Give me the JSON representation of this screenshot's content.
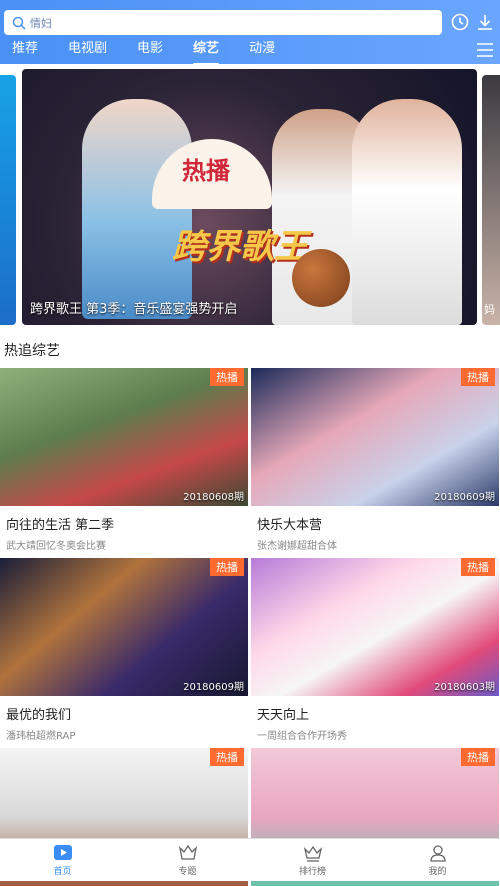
{
  "search": {
    "placeholder": "情妇"
  },
  "header_icons": [
    "history-icon",
    "download-icon"
  ],
  "tabs": [
    {
      "label": "推荐"
    },
    {
      "label": "电视剧"
    },
    {
      "label": "电影"
    },
    {
      "label": "综艺",
      "active": true
    },
    {
      "label": "动漫"
    }
  ],
  "banner": {
    "caption": "跨界歌王 第3季：音乐盛宴强势开启",
    "fan_text": "热播",
    "logo_text": "跨界歌王",
    "right_peek": "妈"
  },
  "section": {
    "title": "热追综艺"
  },
  "cards": [
    {
      "badge": "热播",
      "date": "20180608期",
      "name": "向往的生活 第二季",
      "desc": "武大靖回忆冬奥会比赛"
    },
    {
      "badge": "热播",
      "date": "20180609期",
      "name": "快乐大本营",
      "desc": "张杰谢娜超甜合体"
    },
    {
      "badge": "热播",
      "date": "20180609期",
      "name": "最优的我们",
      "desc": "潘玮柏超燃RAP"
    },
    {
      "badge": "热播",
      "date": "20180603期",
      "name": "天天向上",
      "desc": "一周组合合作开场秀"
    },
    {
      "badge": "热播",
      "date": "",
      "name": "",
      "desc": ""
    },
    {
      "badge": "热播",
      "date": "",
      "name": "",
      "desc": ""
    }
  ],
  "bottom_nav": [
    {
      "label": "首页",
      "icon": "home-play-icon",
      "active": true
    },
    {
      "label": "专题",
      "icon": "crown-outline-icon"
    },
    {
      "label": "排行榜",
      "icon": "crown-icon"
    },
    {
      "label": "我的",
      "icon": "user-icon"
    }
  ],
  "colors": {
    "accent": "#4a90f5",
    "badge": "#ff6a30"
  }
}
